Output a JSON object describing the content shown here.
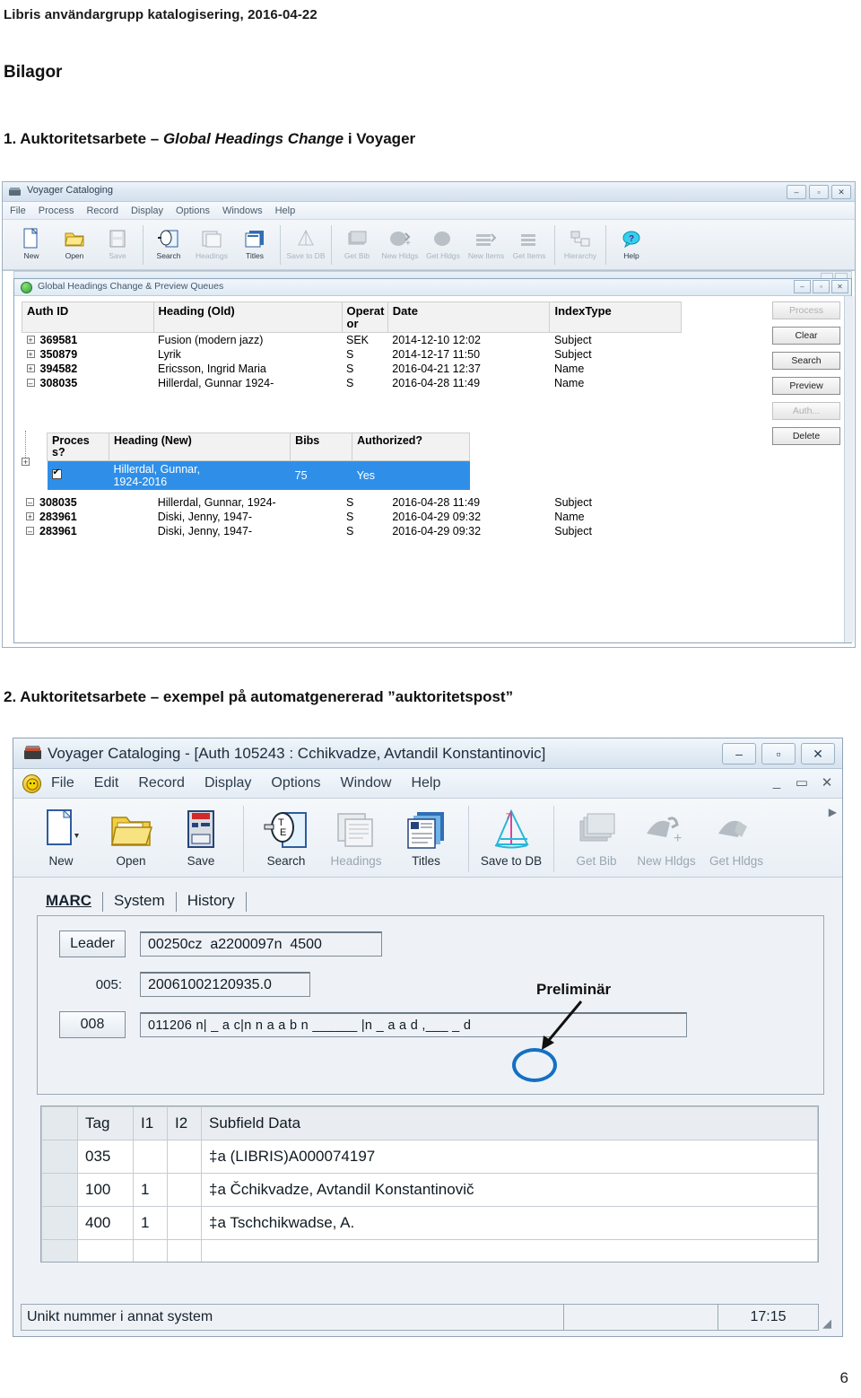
{
  "document": {
    "header": "Libris användargrupp katalogisering, 2016-04-22",
    "h1": "Bilagor",
    "section1_num": "1. Auktoritetsarbete – ",
    "section1_italic": "Global Headings Change",
    "section1_tail": " i Voyager",
    "section2": "2. Auktoritetsarbete – exempel på automatgenererad ”auktoritetspost”",
    "page_number": "6"
  },
  "shot1": {
    "window_title": "Voyager Cataloging",
    "menus": [
      "File",
      "Process",
      "Record",
      "Display",
      "Options",
      "Windows",
      "Help"
    ],
    "toolbar": [
      {
        "label": "New",
        "icon": "new-document-icon",
        "enabled": true
      },
      {
        "label": "Open",
        "icon": "open-folder-icon",
        "enabled": true
      },
      {
        "label": "Save",
        "icon": "save-disk-icon",
        "enabled": false
      },
      {
        "label": "Search",
        "icon": "search-icon",
        "enabled": true
      },
      {
        "label": "Headings",
        "icon": "headings-icon",
        "enabled": false
      },
      {
        "label": "Titles",
        "icon": "titles-icon",
        "enabled": true
      },
      {
        "label": "Save to DB",
        "icon": "save-to-db-icon",
        "enabled": false
      },
      {
        "label": "Get Bib",
        "icon": "get-bib-icon",
        "enabled": false
      },
      {
        "label": "New Hldgs",
        "icon": "new-holdings-icon",
        "enabled": false
      },
      {
        "label": "Get Hldgs",
        "icon": "get-holdings-icon",
        "enabled": false
      },
      {
        "label": "New Items",
        "icon": "new-items-icon",
        "enabled": false
      },
      {
        "label": "Get Items",
        "icon": "get-items-icon",
        "enabled": false
      },
      {
        "label": "Hierarchy",
        "icon": "hierarchy-icon",
        "enabled": false
      },
      {
        "label": "Help",
        "icon": "help-icon",
        "enabled": true
      }
    ],
    "window_buttons": [
      "–",
      "▫",
      "✕"
    ],
    "ghc": {
      "title": "Global Headings Change &  Preview Queues",
      "columns": [
        "Auth ID",
        "Heading (Old)",
        "Operat or",
        "Date",
        "IndexType"
      ],
      "rows_before": [
        {
          "auth_id": "369581",
          "expander": "+",
          "heading": "Fusion (modern jazz)",
          "operator": "SEK",
          "date": "2014-12-10 12:02",
          "index_type": "Subject"
        },
        {
          "auth_id": "350879",
          "expander": "+",
          "heading": "Lyrik",
          "operator": "S",
          "date": "2014-12-17 11:50",
          "index_type": "Subject"
        },
        {
          "auth_id": "394582",
          "expander": "+",
          "heading": "Ericsson, Ingrid Maria",
          "operator": "S",
          "date": "2016-04-21 12:37",
          "index_type": "Name"
        },
        {
          "auth_id": "308035",
          "expander": "–",
          "heading": "Hillerdal, Gunnar 1924-",
          "operator": "S",
          "date": "2016-04-28 11:49",
          "index_type": "Name"
        }
      ],
      "sub_columns": [
        "Proces s?",
        "Heading (New)",
        "Bibs",
        "Authorized?"
      ],
      "sub_row": {
        "process_checked": true,
        "expander": "+",
        "heading_new_line1": "Hillerdal, Gunnar,",
        "heading_new_line2": "1924-2016",
        "bibs": "75",
        "authorized": "Yes"
      },
      "rows_after": [
        {
          "auth_id": "308035",
          "expander": "–",
          "heading": "Hillerdal, Gunnar, 1924-",
          "operator": "S",
          "date": "2016-04-28 11:49",
          "index_type": "Subject"
        },
        {
          "auth_id": "283961",
          "expander": "+",
          "heading": "Diski, Jenny, 1947-",
          "operator": "S",
          "date": "2016-04-29 09:32",
          "index_type": "Name"
        },
        {
          "auth_id": "283961",
          "expander": "–",
          "heading": "Diski, Jenny, 1947-",
          "operator": "S",
          "date": "2016-04-29 09:32",
          "index_type": "Subject"
        }
      ],
      "side_buttons": [
        {
          "label": "Process",
          "enabled": false
        },
        {
          "label": "Clear",
          "enabled": true
        },
        {
          "label": "Search",
          "enabled": true
        },
        {
          "label": "Preview",
          "enabled": true
        },
        {
          "label": "Auth...",
          "enabled": false
        },
        {
          "label": "Delete",
          "enabled": true
        }
      ]
    },
    "annotation": {
      "shape": "red-circle",
      "color": "#b51a1a",
      "target": "Process? checkbox"
    }
  },
  "shot2": {
    "window_title": "Voyager Cataloging - [Auth 105243 : Cchikvadze, Avtandil Konstantinovic]",
    "menus": [
      "File",
      "Edit",
      "Record",
      "Display",
      "Options",
      "Window",
      "Help"
    ],
    "window_buttons": [
      "–",
      "▫",
      "✕"
    ],
    "mdi_buttons": [
      "_",
      "▭",
      "✕"
    ],
    "toolbar": [
      {
        "label": "New",
        "icon": "new-document-icon",
        "enabled": true
      },
      {
        "label": "Open",
        "icon": "open-folder-icon",
        "enabled": true
      },
      {
        "label": "Save",
        "icon": "save-disk-icon",
        "enabled": true
      },
      {
        "label": "Search",
        "icon": "search-icon",
        "enabled": true
      },
      {
        "label": "Headings",
        "icon": "headings-icon",
        "enabled": false
      },
      {
        "label": "Titles",
        "icon": "titles-icon",
        "enabled": true
      },
      {
        "label": "Save to DB",
        "icon": "save-to-db-icon",
        "enabled": true
      },
      {
        "label": "Get Bib",
        "icon": "get-bib-icon",
        "enabled": false
      },
      {
        "label": "New Hldgs",
        "icon": "new-holdings-icon",
        "enabled": false
      },
      {
        "label": "Get Hldgs",
        "icon": "get-holdings-icon",
        "enabled": false
      }
    ],
    "tabs": [
      {
        "label": "MARC",
        "active": true
      },
      {
        "label": "System",
        "active": false
      },
      {
        "label": "History",
        "active": false
      }
    ],
    "fixed_fields": {
      "leader_label": "Leader",
      "leader_value": "00250cz  a2200097n  4500",
      "f005_label": "005:",
      "f005_value": "20061002120935.0",
      "f008_label": "008",
      "f008_value": "011206 n| _ a c|n n a a b n ______ |n _ a a d ,___ _ d"
    },
    "annotation": {
      "label": "Preliminär",
      "shape": "blue-circle",
      "color": "#1570c4"
    },
    "marc_columns": [
      "",
      "Tag",
      "I1",
      "I2",
      "Subfield Data"
    ],
    "marc_rows": [
      {
        "tag": "035",
        "i1": "",
        "i2": "",
        "subfield": "‡a (LIBRIS)A000074197"
      },
      {
        "tag": "100",
        "i1": "1",
        "i2": "",
        "subfield": "‡a Čchikvadze, Avtandil Konstantinovič"
      },
      {
        "tag": "400",
        "i1": "1",
        "i2": "",
        "subfield": "‡a Tschchikwadse, A."
      }
    ],
    "status": {
      "message": "Unikt nummer i annat system",
      "middle": "",
      "time": "17:15"
    }
  }
}
